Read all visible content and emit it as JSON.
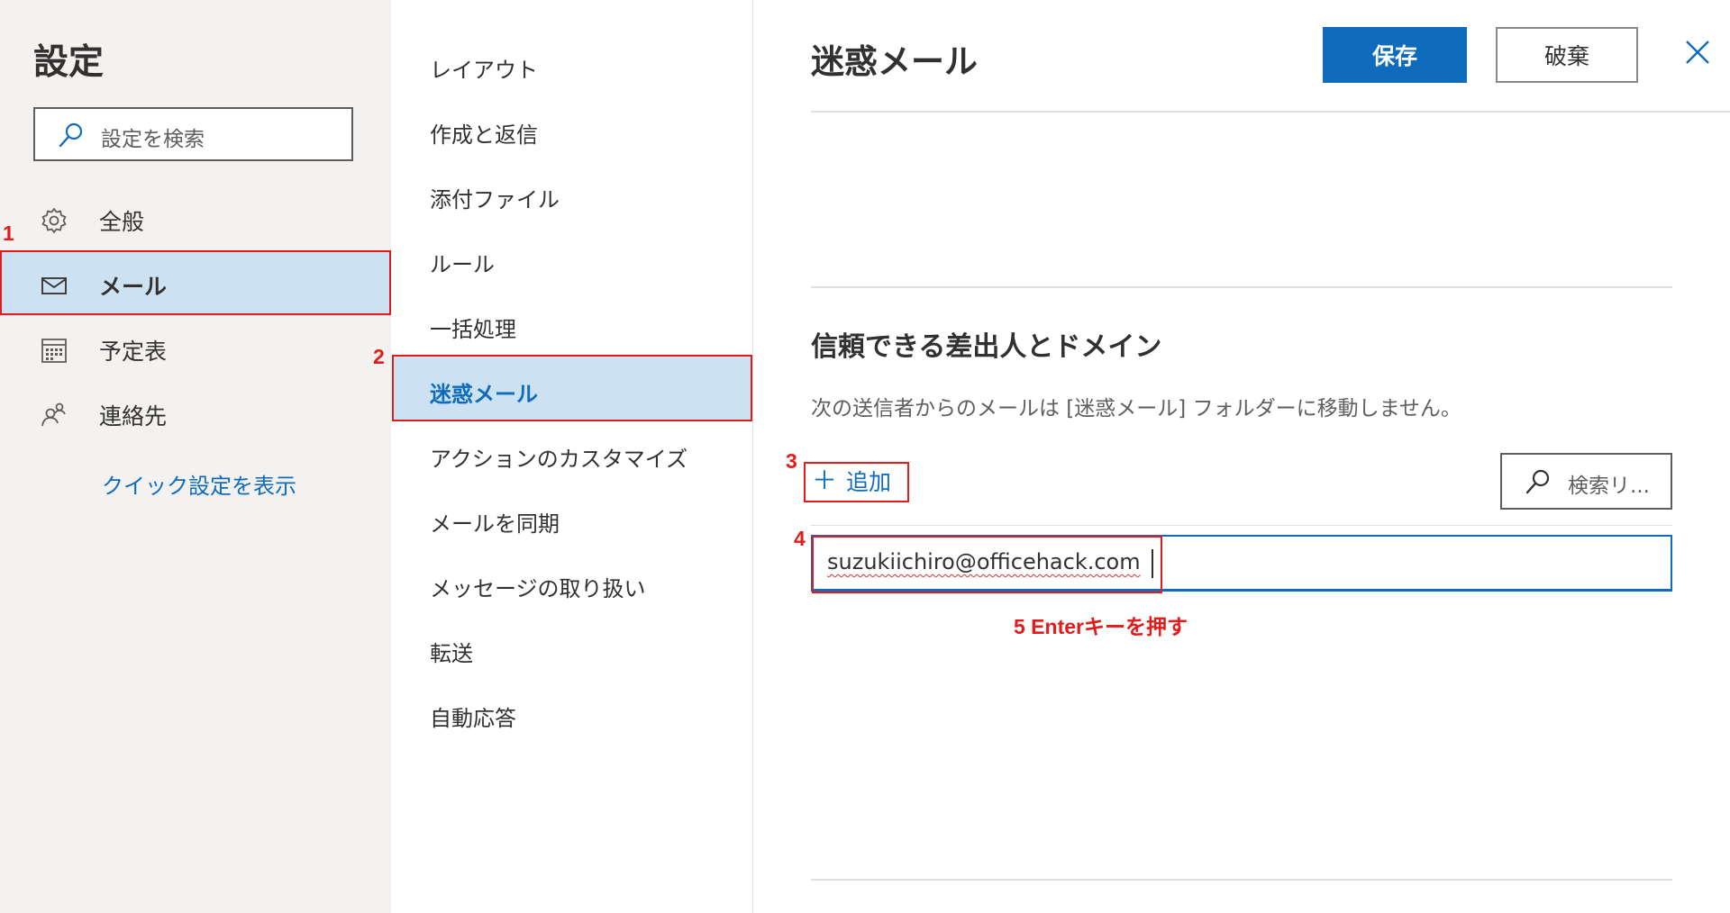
{
  "settings": {
    "title": "設定",
    "search_placeholder": "設定を検索",
    "nav": [
      {
        "label": "全般",
        "icon": "gear-icon"
      },
      {
        "label": "メール",
        "icon": "mail-icon",
        "selected": true
      },
      {
        "label": "予定表",
        "icon": "calendar-icon"
      },
      {
        "label": "連絡先",
        "icon": "people-icon"
      }
    ],
    "quick_settings_link": "クイック設定を表示"
  },
  "mail_menu": {
    "items": [
      {
        "label": "レイアウト"
      },
      {
        "label": "作成と返信"
      },
      {
        "label": "添付ファイル"
      },
      {
        "label": "ルール"
      },
      {
        "label": "一括処理"
      },
      {
        "label": "迷惑メール",
        "selected": true
      },
      {
        "label": "アクションのカスタマイズ"
      },
      {
        "label": "メールを同期"
      },
      {
        "label": "メッセージの取り扱い"
      },
      {
        "label": "転送"
      },
      {
        "label": "自動応答"
      }
    ]
  },
  "junk": {
    "title": "迷惑メール",
    "save_label": "保存",
    "discard_label": "破棄",
    "safe_section": {
      "title": "信頼できる差出人とドメイン",
      "description": "次の送信者からのメールは [迷惑メール] フォルダーに移動しません。",
      "add_label": "追加",
      "search_label": "検索リ...",
      "input_value": "suzukiichiro@officehack.com"
    }
  },
  "annotations": {
    "step1": "1",
    "step2": "2",
    "step3": "3",
    "step4": "4",
    "step5": "5 Enterキーを押す",
    "color": "#e21b1b"
  },
  "colors": {
    "accent": "#0f6cbd",
    "selected_bg": "#cce1f2",
    "left_pane_bg": "#f3f2f1"
  }
}
